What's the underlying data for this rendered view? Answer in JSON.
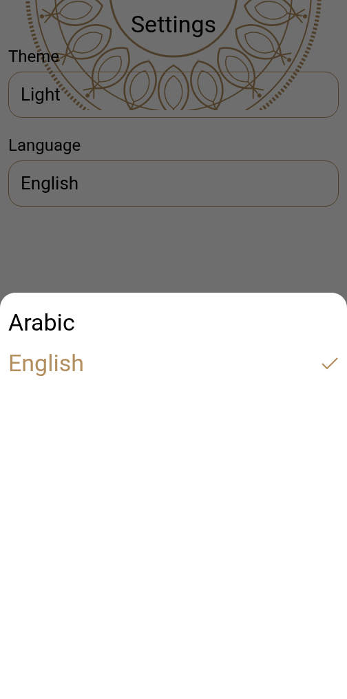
{
  "title": "Settings",
  "fields": [
    {
      "label": "Theme",
      "value": "Light"
    },
    {
      "label": "Language",
      "value": "English"
    }
  ],
  "language_sheet": {
    "options": [
      {
        "label": "Arabic",
        "selected": false
      },
      {
        "label": "English",
        "selected": true
      }
    ]
  }
}
